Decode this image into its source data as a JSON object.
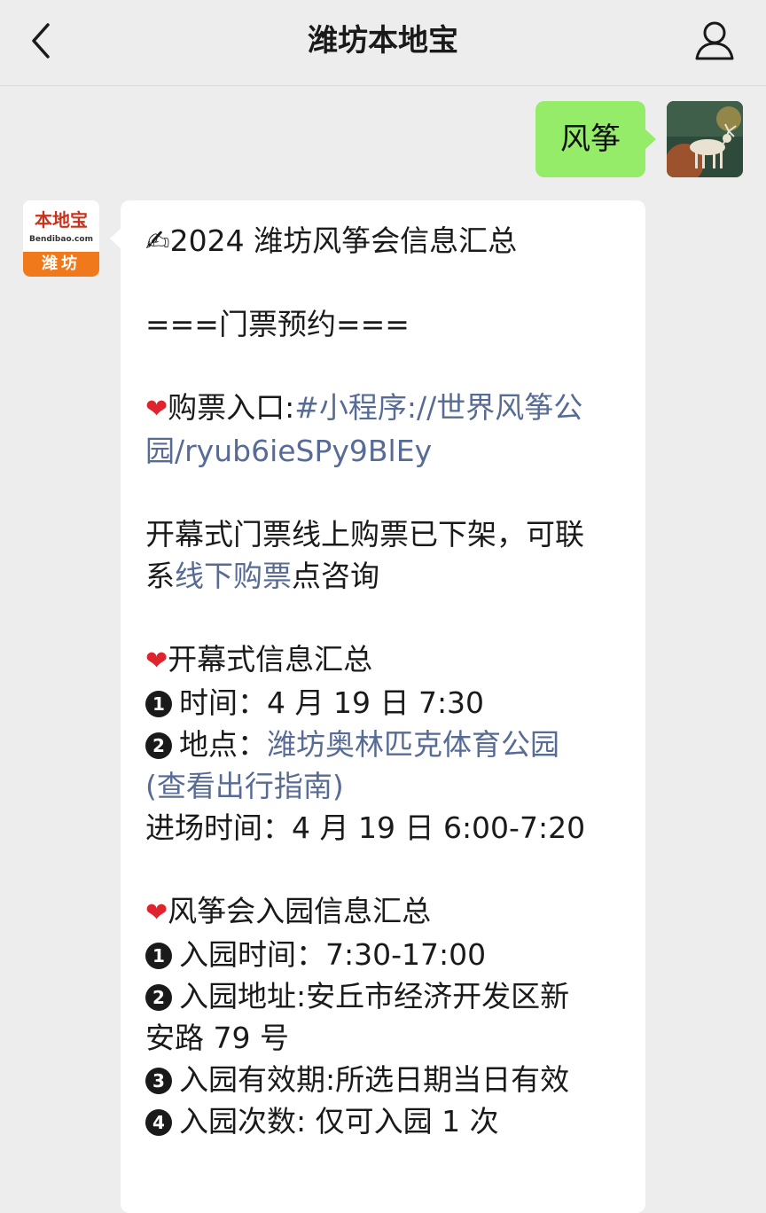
{
  "header": {
    "title": "潍坊本地宝",
    "back_icon": "chevron-left-icon",
    "profile_icon": "person-icon"
  },
  "outgoing_message": {
    "text": "风筝"
  },
  "bot_avatar": {
    "logo_text": "本地宝",
    "logo_sub": "Bendibao.com",
    "city": "潍坊"
  },
  "incoming_message": {
    "title_icon": "✍",
    "title": "2024 潍坊风筝会信息汇总",
    "section_tickets": "===门票预约===",
    "heart": "❤",
    "purchase_label": "购票入口:",
    "purchase_link_1": "#小程序://世界风筝公",
    "purchase_link_2": "园/ryub6ieSPy9BlEy",
    "opening_notice_1": "开幕式门票线上购票已下架，可联",
    "opening_notice_2_pre": "系",
    "opening_notice_2_link": "线下购票",
    "opening_notice_2_post": "点咨询",
    "opening_title": "开幕式信息汇总",
    "opening_items": {
      "n1": "1",
      "time": "时间：4 月 19 日 7:30",
      "n2": "2",
      "place_label": "地点：",
      "place_link_1": "潍坊奥林匹克体育公园",
      "place_link_2": "(查看出行指南)",
      "entry_time": "进场时间：4 月 19 日 6:00-7:20"
    },
    "kite_title": "风筝会入园信息汇总",
    "kite_items": {
      "n1": "1",
      "time": "入园时间：7:30-17:00",
      "n2": "2",
      "address_1": "入园地址:安丘市经济开发区新",
      "address_2": "安路 79 号",
      "n3": "3",
      "validity": "入园有效期:所选日期当日有效",
      "n4": "4",
      "count": "入园次数: 仅可入园 1 次"
    }
  },
  "colors": {
    "background": "#ededed",
    "outgoing_bubble": "#95ec69",
    "incoming_bubble": "#ffffff",
    "link": "#576b95",
    "heart": "#e0242e",
    "brand_orange": "#f07a1b"
  }
}
